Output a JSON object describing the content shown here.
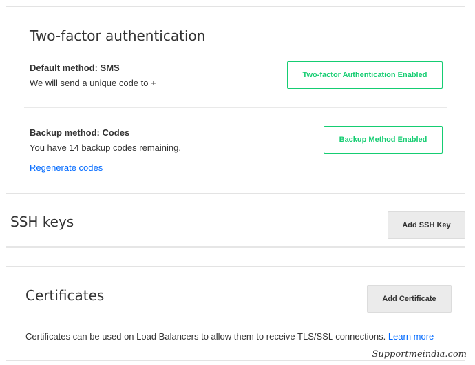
{
  "two_factor": {
    "title": "Two-factor authentication",
    "default_method": {
      "label": "Default method: SMS",
      "description": "We will send a unique code to +",
      "button": "Two-factor Authentication Enabled"
    },
    "backup_method": {
      "label": "Backup method: Codes",
      "description": "You have 14 backup codes remaining.",
      "button": "Backup Method Enabled",
      "regenerate_link": "Regenerate codes"
    }
  },
  "ssh_keys": {
    "title": "SSH keys",
    "add_button": "Add SSH Key"
  },
  "certificates": {
    "title": "Certificates",
    "add_button": "Add Certificate",
    "description": "Certificates can be used on Load Balancers to allow them to receive TLS/SSL connections.",
    "learn_more": "Learn more"
  },
  "watermark": "Supportmeindia.com",
  "colors": {
    "accent_green": "#15cd72",
    "link_blue": "#0069ff",
    "button_gray": "#ebebeb",
    "border": "#e3e3e3"
  }
}
